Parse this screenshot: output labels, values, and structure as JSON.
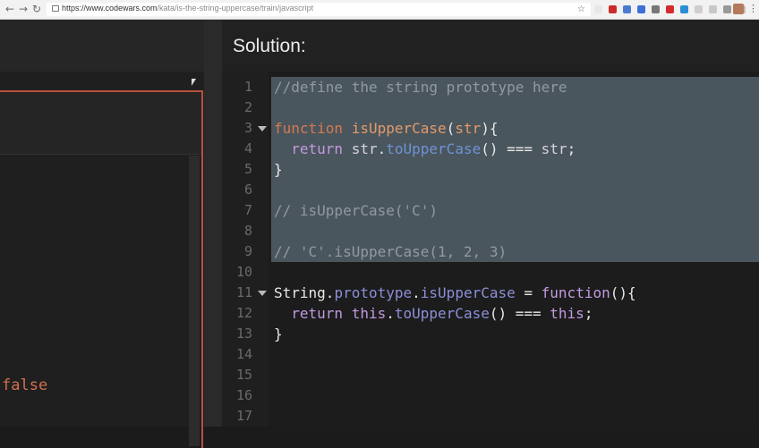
{
  "browser": {
    "url_host": "https://www.codewars.com",
    "url_path": "/kata/is-the-string-uppercase/train/javascript",
    "back_icon": "←",
    "forward_icon": "→",
    "reload_icon": "↻",
    "star_icon": "☆",
    "menu_icon": "⋮",
    "extension_colors": [
      "#e8e8e8",
      "#cc2b2b",
      "#4a7bd1",
      "#3f6fd8",
      "#777777",
      "#d22d2d",
      "#2a8fd6",
      "#cfcfcf",
      "#c8c8c8",
      "#9a9a9a",
      "#bdbdbd"
    ]
  },
  "left": {
    "output_text": "false"
  },
  "solution": {
    "title": "Solution:",
    "lines": [
      {
        "num": "1",
        "tokens": [
          {
            "t": "//define the string prototype here",
            "c": "t-comment"
          }
        ]
      },
      {
        "num": "2",
        "tokens": []
      },
      {
        "num": "3",
        "tokens": [
          {
            "t": "function ",
            "c": "t-keyword"
          },
          {
            "t": "isUpperCase",
            "c": "t-func"
          },
          {
            "t": "(",
            "c": "t-plain"
          },
          {
            "t": "str",
            "c": "t-func"
          },
          {
            "t": "){",
            "c": "t-plain"
          }
        ]
      },
      {
        "num": "4",
        "tokens": [
          {
            "t": "  return ",
            "c": "t-kw2"
          },
          {
            "t": "str",
            "c": "t-builtin"
          },
          {
            "t": ".",
            "c": "t-plain"
          },
          {
            "t": "toUpperCase",
            "c": "t-method"
          },
          {
            "t": "() === ",
            "c": "t-plain"
          },
          {
            "t": "str",
            "c": "t-builtin"
          },
          {
            "t": ";",
            "c": "t-plain"
          }
        ]
      },
      {
        "num": "5",
        "tokens": [
          {
            "t": "}",
            "c": "t-plain"
          }
        ]
      },
      {
        "num": "6",
        "tokens": []
      },
      {
        "num": "7",
        "tokens": [
          {
            "t": "// isUpperCase('C')",
            "c": "t-comment"
          }
        ]
      },
      {
        "num": "8",
        "tokens": []
      },
      {
        "num": "9",
        "tokens": [
          {
            "t": "// 'C'.isUpperCase(1, 2, 3)",
            "c": "t-comment"
          }
        ]
      },
      {
        "num": "10",
        "tokens": []
      },
      {
        "num": "11",
        "tokens": [
          {
            "t": "String",
            "c": "t-plain"
          },
          {
            "t": ".",
            "c": "t-plain"
          },
          {
            "t": "prototype",
            "c": "t-prop"
          },
          {
            "t": ".",
            "c": "t-plain"
          },
          {
            "t": "isUpperCase",
            "c": "t-prop"
          },
          {
            "t": " = ",
            "c": "t-plain"
          },
          {
            "t": "function",
            "c": "t-kw2"
          },
          {
            "t": "(){",
            "c": "t-plain"
          }
        ]
      },
      {
        "num": "12",
        "tokens": [
          {
            "t": "  return ",
            "c": "t-kw2"
          },
          {
            "t": "this",
            "c": "t-kw2"
          },
          {
            "t": ".",
            "c": "t-plain"
          },
          {
            "t": "toUpperCase",
            "c": "t-prop"
          },
          {
            "t": "() === ",
            "c": "t-plain"
          },
          {
            "t": "this",
            "c": "t-kw2"
          },
          {
            "t": ";",
            "c": "t-plain"
          }
        ]
      },
      {
        "num": "13",
        "tokens": [
          {
            "t": "}",
            "c": "t-plain"
          }
        ]
      },
      {
        "num": "14",
        "tokens": []
      },
      {
        "num": "15",
        "tokens": []
      },
      {
        "num": "16",
        "tokens": []
      },
      {
        "num": "17",
        "tokens": []
      }
    ],
    "fold_lines": [
      "3",
      "11"
    ],
    "selected_lines": [
      "1",
      "2",
      "3",
      "4",
      "5",
      "6",
      "7",
      "8",
      "9"
    ],
    "selection_color": "#4a565d"
  }
}
